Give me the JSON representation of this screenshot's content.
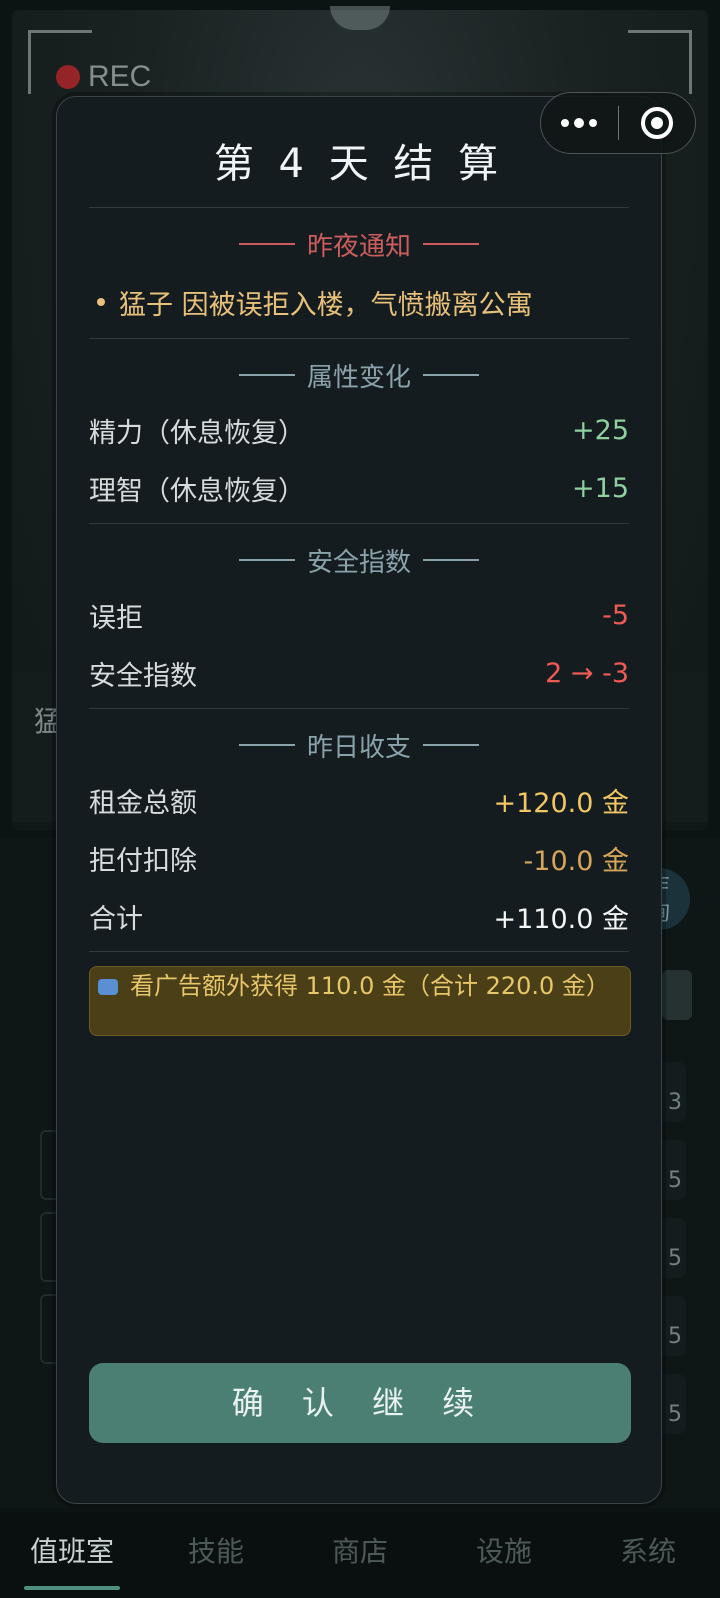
{
  "background": {
    "rec_label": "REC",
    "strip_text": "猛",
    "side_button_text": "乍\n询",
    "slot_values": [
      "3",
      "5",
      "5",
      "5",
      "5"
    ]
  },
  "modal": {
    "title": "第 4 天 结 算",
    "notice_section": {
      "title": "昨夜通知",
      "items": [
        "猛子 因被误拒入楼，气愤搬离公寓"
      ]
    },
    "attributes_section": {
      "title": "属性变化",
      "rows": [
        {
          "label": "精力（休息恢复）",
          "value": "+25"
        },
        {
          "label": "理智（休息恢复）",
          "value": "+15"
        }
      ]
    },
    "safety_section": {
      "title": "安全指数",
      "rows": [
        {
          "label": "误拒",
          "value": "-5"
        },
        {
          "label": "安全指数",
          "value": "2 → -3"
        }
      ]
    },
    "income_section": {
      "title": "昨日收支",
      "rows": [
        {
          "label": "租金总额",
          "value": "+120.0 金"
        },
        {
          "label": "拒付扣除",
          "value": "-10.0 金"
        },
        {
          "label": "合计",
          "value": "+110.0 金"
        }
      ]
    },
    "ad_offer": "看广告额外获得 110.0 金（合计 220.0 金）",
    "confirm_label": "确 认 继 续"
  },
  "bottom_nav": {
    "items": [
      "值班室",
      "技能",
      "商店",
      "设施",
      "系统"
    ],
    "active": "值班室"
  },
  "colors": {
    "accent": "#4b7f74",
    "positive": "#8fd19e",
    "negative": "#ee5b55",
    "gold": "#f1c663",
    "notice": "#e8c07a"
  },
  "icons": [
    "more-dots-icon",
    "close-target-icon",
    "ad-video-icon",
    "rec-dot-icon"
  ]
}
